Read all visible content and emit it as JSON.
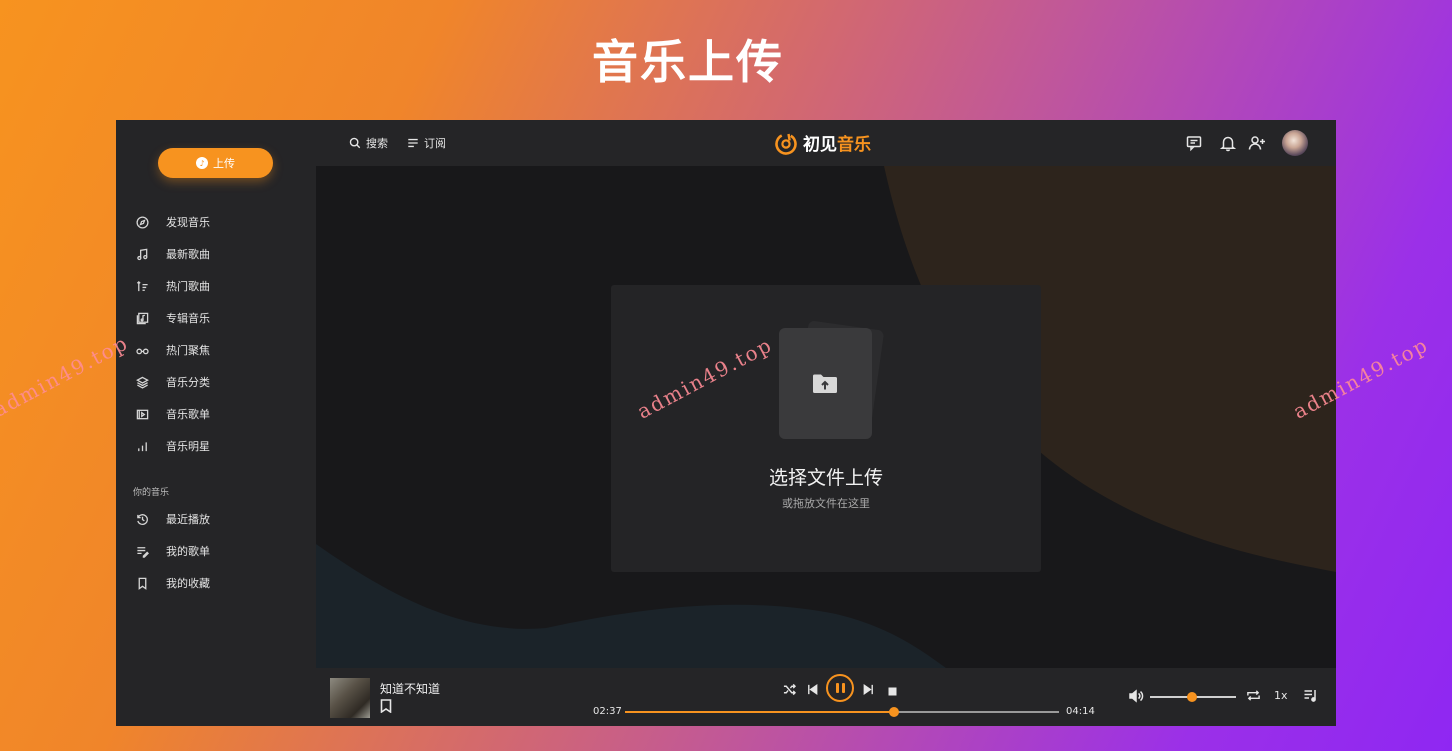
{
  "page_heading": "音乐上传",
  "watermark_text": "admin49.top",
  "colors": {
    "accent": "#f7931f",
    "panel": "#252527",
    "main_bg": "#18181a"
  },
  "sidebar": {
    "upload_label": "上传",
    "items": [
      {
        "label": "发现音乐",
        "icon": "compass-icon"
      },
      {
        "label": "最新歌曲",
        "icon": "music-note-icon"
      },
      {
        "label": "热门歌曲",
        "icon": "sort-list-icon"
      },
      {
        "label": "专辑音乐",
        "icon": "album-icon"
      },
      {
        "label": "热门聚焦",
        "icon": "glasses-icon"
      },
      {
        "label": "音乐分类",
        "icon": "layers-icon"
      },
      {
        "label": "音乐歌单",
        "icon": "playlist-video-icon"
      },
      {
        "label": "音乐明星",
        "icon": "bar-chart-icon"
      }
    ],
    "section_label": "你的音乐",
    "my_items": [
      {
        "label": "最近播放",
        "icon": "history-icon"
      },
      {
        "label": "我的歌单",
        "icon": "list-edit-icon"
      },
      {
        "label": "我的收藏",
        "icon": "bookmark-icon"
      }
    ]
  },
  "topbar": {
    "search_label": "搜索",
    "subscribe_label": "订阅",
    "brand_part1": "初见",
    "brand_part2": "音乐",
    "icons": [
      "message-icon",
      "bell-icon",
      "add-user-icon",
      "avatar"
    ]
  },
  "upload_area": {
    "title": "选择文件上传",
    "subtitle": "或拖放文件在这里"
  },
  "player": {
    "track_title": "知道不知道",
    "current_time": "02:37",
    "total_time": "04:14",
    "progress_fraction": 0.62,
    "volume_fraction": 0.49,
    "speed": "1x"
  }
}
